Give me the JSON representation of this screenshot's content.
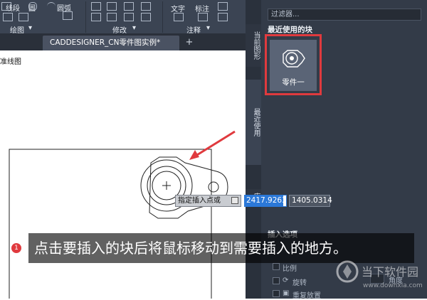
{
  "ribbon": {
    "tools": [
      {
        "label": "线段",
        "icon": "line-tool-icon"
      },
      {
        "label": "圆",
        "icon": "circle-tool-icon"
      },
      {
        "label": "圆弧",
        "icon": "arc-tool-icon"
      },
      {
        "label": "文字",
        "icon": "text-tool-icon"
      },
      {
        "label": "标注",
        "icon": "dimension-tool-icon"
      }
    ],
    "groups": [
      "绘图",
      "修改",
      "注释"
    ]
  },
  "document_tab": {
    "title": "CADDESIGNER_CN零件图实例*",
    "add_label": "+"
  },
  "canvas": {
    "partial_label": "准线图"
  },
  "palette": {
    "filter_placeholder": "过滤器...",
    "section_recent": "最近使用的块",
    "side_tabs": [
      "当前图形",
      "最近使用",
      "库"
    ],
    "recent_blocks": [
      {
        "name": "零件一"
      }
    ],
    "insert_options_title": "插入选项",
    "options": [
      "比例",
      "旋转",
      "重复放置"
    ],
    "angle_label": "角度"
  },
  "command": {
    "prompt": "指定插入点或",
    "x_value": "2417.9263",
    "y_value": "1405.0314"
  },
  "annotation": {
    "step": "1",
    "caption": "点击要插入的块后将鼠标移动到需要插入的地方。",
    "accent": "#e03a3e"
  },
  "watermark": {
    "text": "当下软件园",
    "url": "www.downxia.com"
  }
}
